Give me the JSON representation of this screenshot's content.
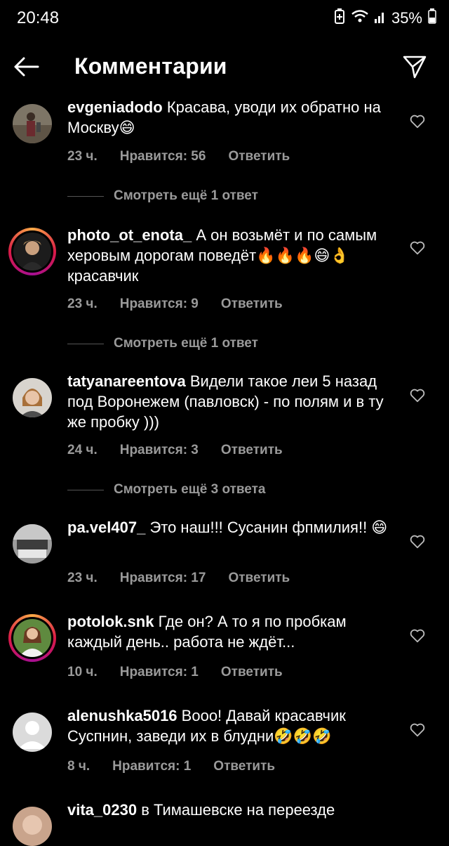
{
  "status": {
    "time": "20:48",
    "battery": "35%"
  },
  "header": {
    "title": "Комментарии"
  },
  "labels": {
    "likes_prefix": "Нравится: ",
    "reply": "Ответить"
  },
  "comments": [
    {
      "username": "evgeniadodo",
      "text": "Красава, уводи их обратно на Москву😄",
      "time": "23 ч.",
      "likes": "Нравится: 56",
      "reply": "Ответить",
      "replies": "Смотреть ещё 1 ответ"
    },
    {
      "username": "photo_ot_enota_",
      "text": "А он возьмёт и по самым херовым дорогам поведёт🔥🔥🔥😄👌 красавчик",
      "time": "23 ч.",
      "likes": "Нравится: 9",
      "reply": "Ответить",
      "replies": "Смотреть ещё 1 ответ"
    },
    {
      "username": "tatyanareentova",
      "text": "Видели такое леи 5 назад под Воронежем (павловск) - по полям и в ту же пробку )))",
      "time": "24 ч.",
      "likes": "Нравится: 3",
      "reply": "Ответить",
      "replies": "Смотреть ещё 3 ответа"
    },
    {
      "username": "pa.vel407_",
      "text": "Это наш!!! Сусанин фпмилия!! 😄",
      "time": "23 ч.",
      "likes": "Нравится: 17",
      "reply": "Ответить"
    },
    {
      "username": "potolok.snk",
      "text": "Где он? А то я по пробкам каждый день.. работа не ждёт...",
      "time": "10 ч.",
      "likes": "Нравится: 1",
      "reply": "Ответить"
    },
    {
      "username": "alenushka5016",
      "text": "Вооо! Давай красавчик Суспнин, заведи их в блудни🤣🤣🤣",
      "time": "8 ч.",
      "likes": "Нравится: 1",
      "reply": "Ответить"
    },
    {
      "username": "vita_0230",
      "text": "в Тимашевске на переезде"
    }
  ]
}
